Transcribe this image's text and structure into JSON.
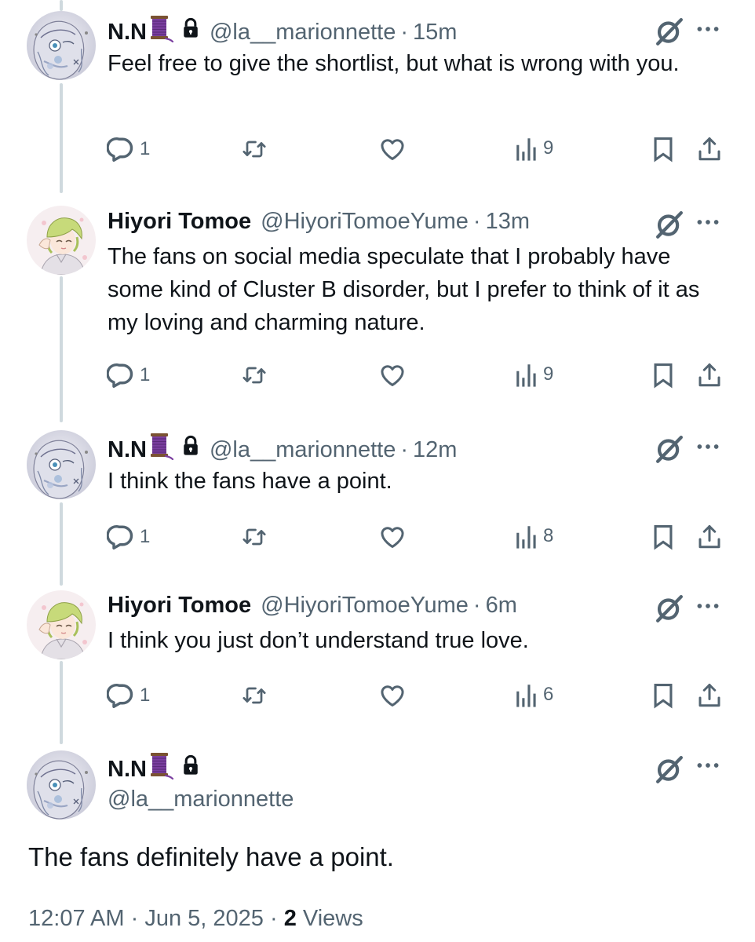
{
  "thread": [
    {
      "name": "N.N",
      "handle": "@la__marionnette",
      "sep": "·",
      "time": "15m",
      "text": "Feel free to give the shortlist, but what is wrong with you.",
      "replies": "1",
      "views": "9",
      "avatar": "marionnette"
    },
    {
      "name": "Hiyori Tomoe",
      "handle": "@HiyoriTomoeYume",
      "sep": "·",
      "time": "13m",
      "text": "The fans on social media speculate that I probably have some kind of Cluster B disorder, but I prefer to think of it as my loving and charming nature.",
      "replies": "1",
      "views": "9",
      "avatar": "hiyori"
    },
    {
      "name": "N.N",
      "handle": "@la__marionnette",
      "sep": "·",
      "time": "12m",
      "text": "I think the fans have a point.",
      "replies": "1",
      "views": "8",
      "avatar": "marionnette"
    },
    {
      "name": "Hiyori Tomoe",
      "handle": "@HiyoriTomoeYume",
      "sep": "·",
      "time": "6m",
      "text": "I think you just don’t understand true love.",
      "replies": "1",
      "views": "6",
      "avatar": "hiyori"
    }
  ],
  "main": {
    "name": "N.N",
    "handle": "@la__marionnette",
    "text": "The fans definitely have a point.",
    "time": "12:07 AM",
    "sep": "·",
    "date": "Jun 5, 2025",
    "views_count": "2",
    "views_label": "Views"
  },
  "icons": {
    "reply": "reply-icon",
    "retweet": "retweet-icon",
    "like": "heart-icon",
    "views": "views-icon",
    "bookmark": "bookmark-icon",
    "share": "share-icon",
    "grok": "grok-icon",
    "more": "more-icon",
    "lock": "lock-icon",
    "spool": "thread-spool-emoji"
  },
  "colors": {
    "text": "#0f1419",
    "secondary": "#536471",
    "thread_line": "#cfd9de",
    "spool": "#7b3fa0"
  }
}
